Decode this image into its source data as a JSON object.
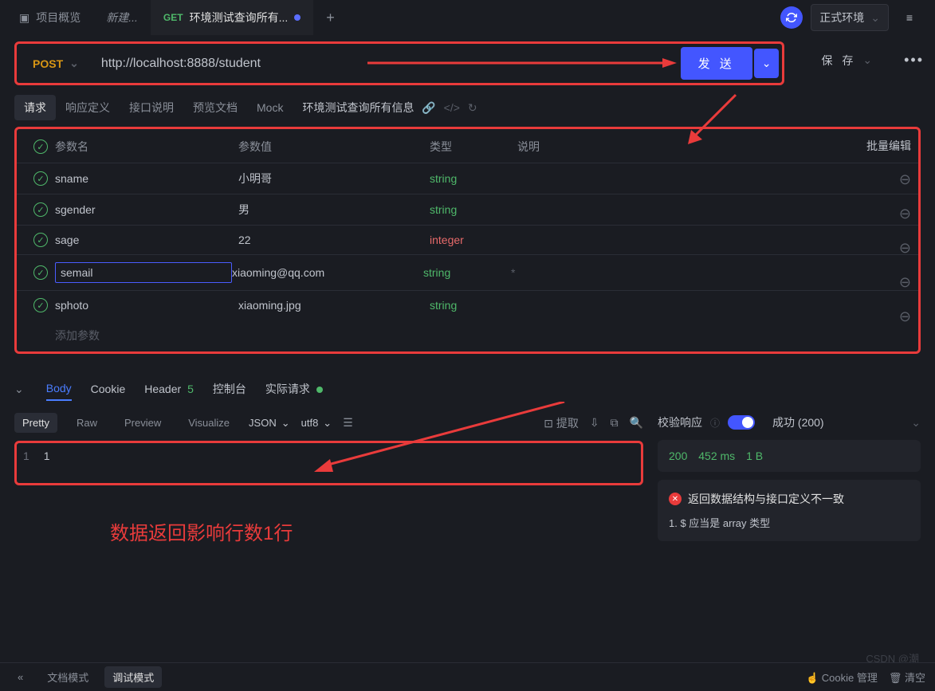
{
  "topTabs": {
    "overview": "项目概览",
    "new": "新建...",
    "activeMethod": "GET",
    "activeTitle": "环境测试查询所有..."
  },
  "env": {
    "label": "正式环境"
  },
  "request": {
    "method": "POST",
    "url": "http://localhost:8888/student",
    "send": "发 送",
    "save": "保 存"
  },
  "subTabs": {
    "req": "请求",
    "respDef": "响应定义",
    "apiDesc": "接口说明",
    "preview": "预览文档",
    "mock": "Mock",
    "breadcrumb": "环境测试查询所有信息"
  },
  "paramsHeader": {
    "name": "参数名",
    "value": "参数值",
    "type": "类型",
    "desc": "说明",
    "batch": "批量编辑",
    "add": "添加参数"
  },
  "params": [
    {
      "name": "sname",
      "value": "小明哥",
      "type": "string",
      "desc": ""
    },
    {
      "name": "sgender",
      "value": "男",
      "type": "string",
      "desc": ""
    },
    {
      "name": "sage",
      "value": "22",
      "type": "integer",
      "desc": ""
    },
    {
      "name": "semail",
      "value": "xiaoming@qq.com",
      "type": "string",
      "desc": "*",
      "editing": true
    },
    {
      "name": "sphoto",
      "value": "xiaoming.jpg",
      "type": "string",
      "desc": ""
    }
  ],
  "respTabs": {
    "body": "Body",
    "cookie": "Cookie",
    "header": "Header",
    "headerCount": "5",
    "console": "控制台",
    "actual": "实际请求"
  },
  "respToolbar": {
    "pretty": "Pretty",
    "raw": "Raw",
    "preview": "Preview",
    "visualize": "Visualize",
    "fmt": "JSON",
    "enc": "utf8",
    "extract": "提取"
  },
  "respBody": {
    "lineNo": "1",
    "value": "1"
  },
  "annotation": "数据返回影响行数1行",
  "validate": {
    "title": "校验响应",
    "success": "成功 (200)",
    "code": "200",
    "time": "452 ms",
    "size": "1 B",
    "errTitle": "返回数据结构与接口定义不一致",
    "errDetail": "1. $ 应当是 array 类型"
  },
  "bottom": {
    "doc": "文档模式",
    "debug": "调试模式",
    "cookie": "Cookie 管理",
    "cleanup": "清空"
  },
  "watermark": "CSDN @潮"
}
